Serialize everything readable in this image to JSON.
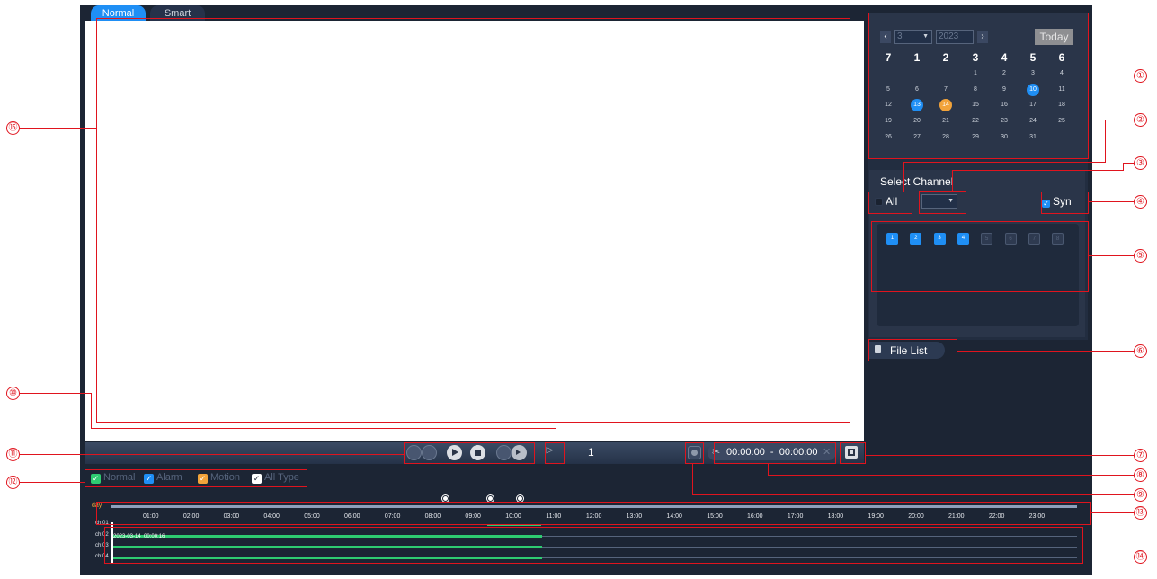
{
  "tabs": {
    "normal": "Normal",
    "smart": "Smart"
  },
  "calendar": {
    "month": "3",
    "year": "2023",
    "prev": "‹",
    "next": "›",
    "today_label": "Today",
    "weekdays": [
      "7",
      "1",
      "2",
      "3",
      "4",
      "5",
      "6"
    ],
    "days": [
      "1",
      "2",
      "3",
      "4",
      "5",
      "6",
      "7",
      "8",
      "9",
      "10",
      "11",
      "12",
      "13",
      "14",
      "15",
      "16",
      "17",
      "18",
      "19",
      "20",
      "21",
      "22",
      "23",
      "24",
      "25",
      "26",
      "27",
      "28",
      "29",
      "30",
      "31"
    ],
    "first_day_column": 3,
    "days_with_recordings": [
      10,
      13
    ],
    "selected_day": 14,
    "colors": {
      "recording": "#1f8ff5",
      "selected": "#f2a33a"
    }
  },
  "channel": {
    "title": "Select Channel",
    "all_label": "All",
    "syn_label": "Syn",
    "syn_checked": true,
    "buttons": [
      {
        "label": "1",
        "active": true
      },
      {
        "label": "2",
        "active": true
      },
      {
        "label": "3",
        "active": true
      },
      {
        "label": "4",
        "active": true
      },
      {
        "label": "5",
        "active": false
      },
      {
        "label": "6",
        "active": false
      },
      {
        "label": "7",
        "active": false
      },
      {
        "label": "8",
        "active": false
      }
    ]
  },
  "file_list": {
    "label": "File List"
  },
  "playback": {
    "speed": "1",
    "clip_time": "00:00:00  -  00:00:00"
  },
  "record_types": [
    {
      "label": "Normal",
      "color": "#2ecc71"
    },
    {
      "label": "Alarm",
      "color": "#1f8ff5"
    },
    {
      "label": "Motion",
      "color": "#f2a33a"
    },
    {
      "label": "All Type",
      "color": "#ffffff"
    }
  ],
  "timeline": {
    "scale_label": "day",
    "hours": [
      "01:00",
      "02:00",
      "03:00",
      "04:00",
      "05:00",
      "06:00",
      "07:00",
      "08:00",
      "09:00",
      "10:00",
      "11:00",
      "12:00",
      "13:00",
      "14:00",
      "15:00",
      "16:00",
      "17:00",
      "18:00",
      "19:00",
      "20:00",
      "21:00",
      "22:00",
      "23:00"
    ],
    "channels": [
      "ch:01",
      "ch:02",
      "ch:03",
      "ch:04"
    ],
    "cursor_label": "2023-03-14  00:00:16",
    "recorded_until_hour": 10.7
  },
  "callouts": [
    "①",
    "②",
    "③",
    "④",
    "⑤",
    "⑥",
    "⑦",
    "⑧",
    "⑨",
    "⑩",
    "⑪",
    "⑫",
    "⑬",
    "⑭",
    "⑮"
  ]
}
